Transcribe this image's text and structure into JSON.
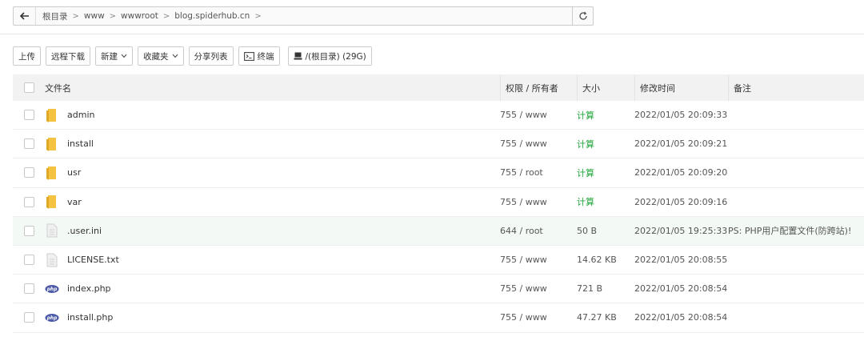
{
  "pathbar": {
    "crumbs": [
      "根目录",
      "www",
      "wwwroot",
      "blog.spiderhub.cn"
    ]
  },
  "toolbar": {
    "upload": "上传",
    "remote_download": "远程下载",
    "new": "新建",
    "favorites": "收藏夹",
    "share_list": "分享列表",
    "terminal": "终端",
    "disk": "/(根目录) (29G)"
  },
  "table": {
    "headers": {
      "name": "文件名",
      "perm": "权限 / 所有者",
      "size": "大小",
      "time": "修改时间",
      "note": "备注"
    },
    "rows": [
      {
        "icon": "folder",
        "name": "admin",
        "perm": "755 / www",
        "size": "计算",
        "time": "2022/01/05 20:09:33",
        "note": ""
      },
      {
        "icon": "folder",
        "name": "install",
        "perm": "755 / www",
        "size": "计算",
        "time": "2022/01/05 20:09:21",
        "note": ""
      },
      {
        "icon": "folder",
        "name": "usr",
        "perm": "755 / root",
        "size": "计算",
        "time": "2022/01/05 20:09:20",
        "note": ""
      },
      {
        "icon": "folder",
        "name": "var",
        "perm": "755 / www",
        "size": "计算",
        "time": "2022/01/05 20:09:16",
        "note": ""
      },
      {
        "icon": "file",
        "name": ".user.ini",
        "perm": "644 / root",
        "size": "50 B",
        "time": "2022/01/05 19:25:33",
        "note": "PS: PHP用户配置文件(防跨站)!"
      },
      {
        "icon": "file",
        "name": "LICENSE.txt",
        "perm": "755 / www",
        "size": "14.62 KB",
        "time": "2022/01/05 20:08:55",
        "note": ""
      },
      {
        "icon": "php",
        "name": "index.php",
        "perm": "755 / www",
        "size": "721 B",
        "time": "2022/01/05 20:08:54",
        "note": ""
      },
      {
        "icon": "php",
        "name": "install.php",
        "perm": "755 / www",
        "size": "47.27 KB",
        "time": "2022/01/05 20:08:54",
        "note": ""
      }
    ]
  },
  "colors": {
    "accent_green": "#20a53a",
    "folder": "#f5c242",
    "php": "#4d5aa8"
  }
}
